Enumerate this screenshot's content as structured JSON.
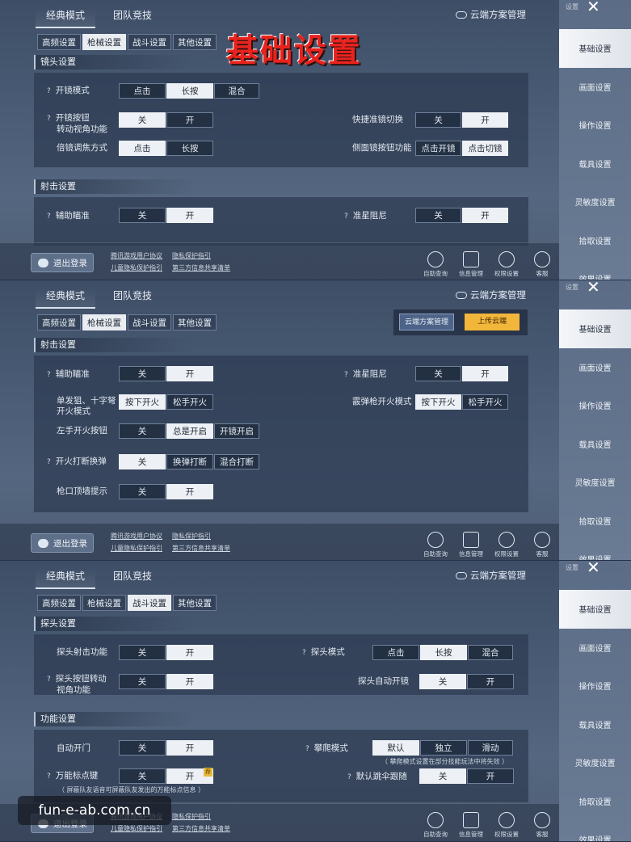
{
  "sidebar": {
    "small_label": "设置",
    "items": [
      "基础设置",
      "画面设置",
      "操作设置",
      "载具设置",
      "灵敏度设置",
      "拾取设置",
      "效果设置"
    ]
  },
  "tabs": {
    "classic": "经典模式",
    "team": "团队竞技"
  },
  "cloud_manage": "云端方案管理",
  "subtabs": [
    "高频设置",
    "枪械设置",
    "战斗设置",
    "其他设置"
  ],
  "overlay_title": "基础设置",
  "bottom": {
    "logout": "退出登录",
    "links": [
      "腾讯游戏用户协议",
      "隐私保护指引",
      "儿童隐私保护指引",
      "第三方信息共享清单"
    ],
    "icons": [
      "自助查询",
      "信息管理",
      "权限设置",
      "客服"
    ]
  },
  "panel1": {
    "lens_header": "镜头设置",
    "shoot_header": "射击设置",
    "scope_mode": {
      "label": "开镜模式",
      "options": [
        "点击",
        "长按",
        "混合"
      ],
      "selected": 1
    },
    "scope_btn_turn": {
      "label1": "开镜按钮",
      "label2": "转动视角功能",
      "options": [
        "关",
        "开"
      ],
      "selected": 0
    },
    "quick_switch": {
      "label": "快捷准镜切换",
      "options": [
        "关",
        "开"
      ],
      "selected": 1
    },
    "zoom_mode": {
      "label": "倍镜调焦方式",
      "options": [
        "点击",
        "长按"
      ],
      "selected": 0
    },
    "side_scope": {
      "label": "侧面镜按钮功能",
      "options": [
        "点击开镜",
        "点击切镜"
      ],
      "selected": 1
    },
    "aim_assist": {
      "label": "辅助瞄准",
      "options": [
        "关",
        "开"
      ],
      "selected": 1
    },
    "crosshair_damp": {
      "label": "准星阻尼",
      "options": [
        "关",
        "开"
      ],
      "selected": 1
    }
  },
  "panel2": {
    "shoot_header": "射击设置",
    "cloud_manage_btn": "云端方案管理",
    "upload_btn": "上传云端",
    "aim_assist": {
      "label": "辅助瞄准",
      "options": [
        "关",
        "开"
      ],
      "selected": 1
    },
    "crosshair_damp": {
      "label": "准星阻尼",
      "options": [
        "关",
        "开"
      ],
      "selected": 1
    },
    "single_fire": {
      "label1": "单发狙、十字弩",
      "label2": "开火模式",
      "options": [
        "按下开火",
        "松手开火"
      ],
      "selected": 0
    },
    "shotgun_fire": {
      "label": "霰弹枪开火模式",
      "options": [
        "按下开火",
        "松手开火"
      ],
      "selected": 0
    },
    "left_fire": {
      "label": "左手开火按钮",
      "options": [
        "关",
        "总是开启",
        "开镜开启"
      ],
      "selected": 1
    },
    "fire_interrupt": {
      "label": "开火打断换弹",
      "options": [
        "关",
        "换弹打断",
        "混合打断"
      ],
      "selected": 0
    },
    "muzzle_wall": {
      "label": "枪口顶墙提示",
      "options": [
        "关",
        "开"
      ],
      "selected": 1
    }
  },
  "panel3": {
    "peek_header": "探头设置",
    "func_header": "功能设置",
    "peek_fire": {
      "label": "探头射击功能",
      "options": [
        "关",
        "开"
      ],
      "selected": 1
    },
    "peek_mode": {
      "label": "探头模式",
      "options": [
        "点击",
        "长按",
        "混合"
      ],
      "selected": 1
    },
    "peek_turn": {
      "label1": "探头按钮转动",
      "label2": "视角功能",
      "options": [
        "关",
        "开"
      ],
      "selected": 1
    },
    "peek_auto_scope": {
      "label": "探头自动开镜",
      "options": [
        "关",
        "开"
      ],
      "selected": 0
    },
    "auto_door": {
      "label": "自动开门",
      "options": [
        "关",
        "开"
      ],
      "selected": 1
    },
    "climb_mode": {
      "label": "攀爬模式",
      "options": [
        "默认",
        "独立",
        "滑动"
      ],
      "selected": 0
    },
    "climb_note": "（ 攀爬模式设置在部分技能玩法中将失效 ）",
    "universal_mark": {
      "label": "万能标点键",
      "options": [
        "关",
        "开"
      ],
      "selected": 1,
      "badge": "荐"
    },
    "mark_note": "（ 屏蔽队友语音可屏蔽队友发出的万能标点信息 ）",
    "default_follow": {
      "label": "默认跳伞跟随",
      "options": [
        "关",
        "开"
      ],
      "selected": 0
    }
  },
  "watermark": "fun-e-ab.com.cn"
}
